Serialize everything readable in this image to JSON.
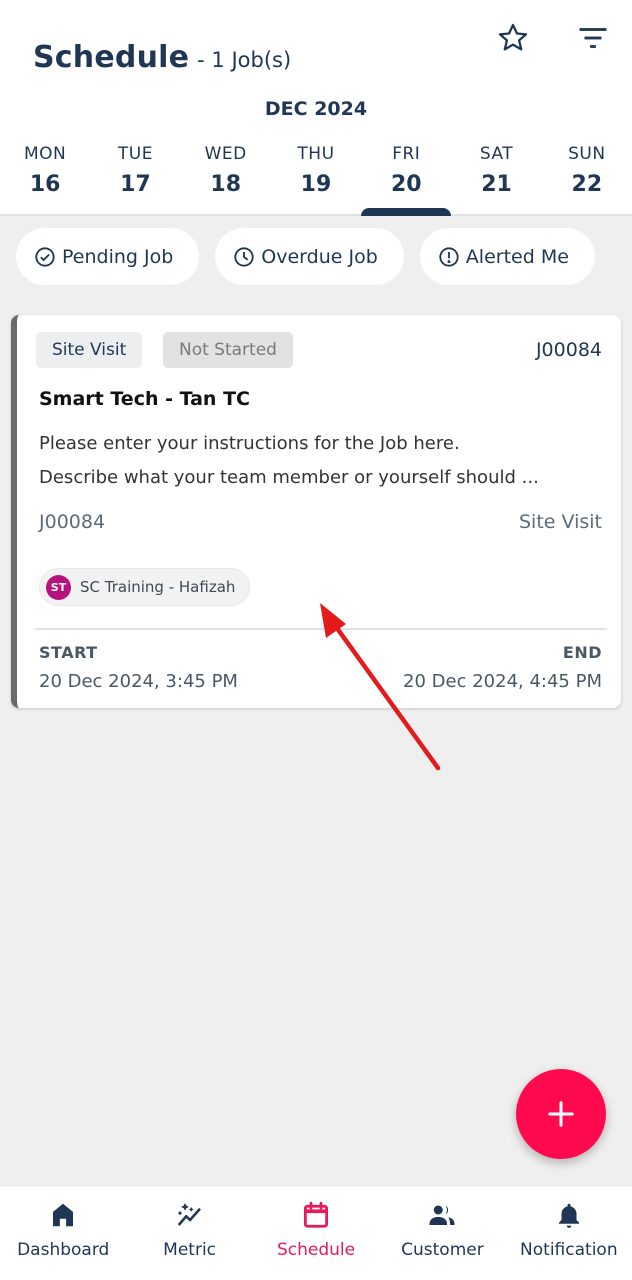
{
  "header": {
    "title": "Schedule",
    "subtitle": "- 1 Job(s)",
    "star_icon": "star-outline-icon",
    "filter_icon": "filter-icon"
  },
  "calendar": {
    "month": "DEC 2024",
    "days": [
      {
        "dow": "MON",
        "num": "16",
        "selected": false
      },
      {
        "dow": "TUE",
        "num": "17",
        "selected": false
      },
      {
        "dow": "WED",
        "num": "18",
        "selected": false
      },
      {
        "dow": "THU",
        "num": "19",
        "selected": false
      },
      {
        "dow": "FRI",
        "num": "20",
        "selected": true
      },
      {
        "dow": "SAT",
        "num": "21",
        "selected": false
      },
      {
        "dow": "SUN",
        "num": "22",
        "selected": false
      }
    ]
  },
  "filters": [
    {
      "label": "Pending Job",
      "icon": "check-circle-icon"
    },
    {
      "label": "Overdue Job",
      "icon": "clock-icon"
    },
    {
      "label": "Alerted Me",
      "icon": "alert-circle-icon"
    }
  ],
  "job": {
    "type_tag": "Site Visit",
    "status_tag": "Not Started",
    "id": "J00084",
    "title": "Smart Tech - Tan TC",
    "description_line1": "Please enter your instructions for the Job here.",
    "description_line2": "Describe what your team member or yourself should ...",
    "id_bottom": "J00084",
    "type_bottom": "Site Visit",
    "assignee_initials": "ST",
    "assignee_name": "SC Training - Hafizah",
    "start_label": "START",
    "start_value": "20 Dec 2024, 3:45 PM",
    "end_label": "END",
    "end_value": "20 Dec 2024, 4:45 PM"
  },
  "fab": {
    "icon": "plus-icon"
  },
  "nav": [
    {
      "label": "Dashboard",
      "icon": "home-icon",
      "active": false
    },
    {
      "label": "Metric",
      "icon": "sparkle-chart-icon",
      "active": false
    },
    {
      "label": "Schedule",
      "icon": "calendar-icon",
      "active": true
    },
    {
      "label": "Customer",
      "icon": "people-icon",
      "active": false
    },
    {
      "label": "Notification",
      "icon": "bell-icon",
      "active": false
    }
  ],
  "colors": {
    "primary": "#1f3654",
    "accent": "#ff0a4f",
    "nav_active": "#e8195a",
    "avatar": "#b5127e",
    "annotation_arrow": "#e31b1b"
  }
}
